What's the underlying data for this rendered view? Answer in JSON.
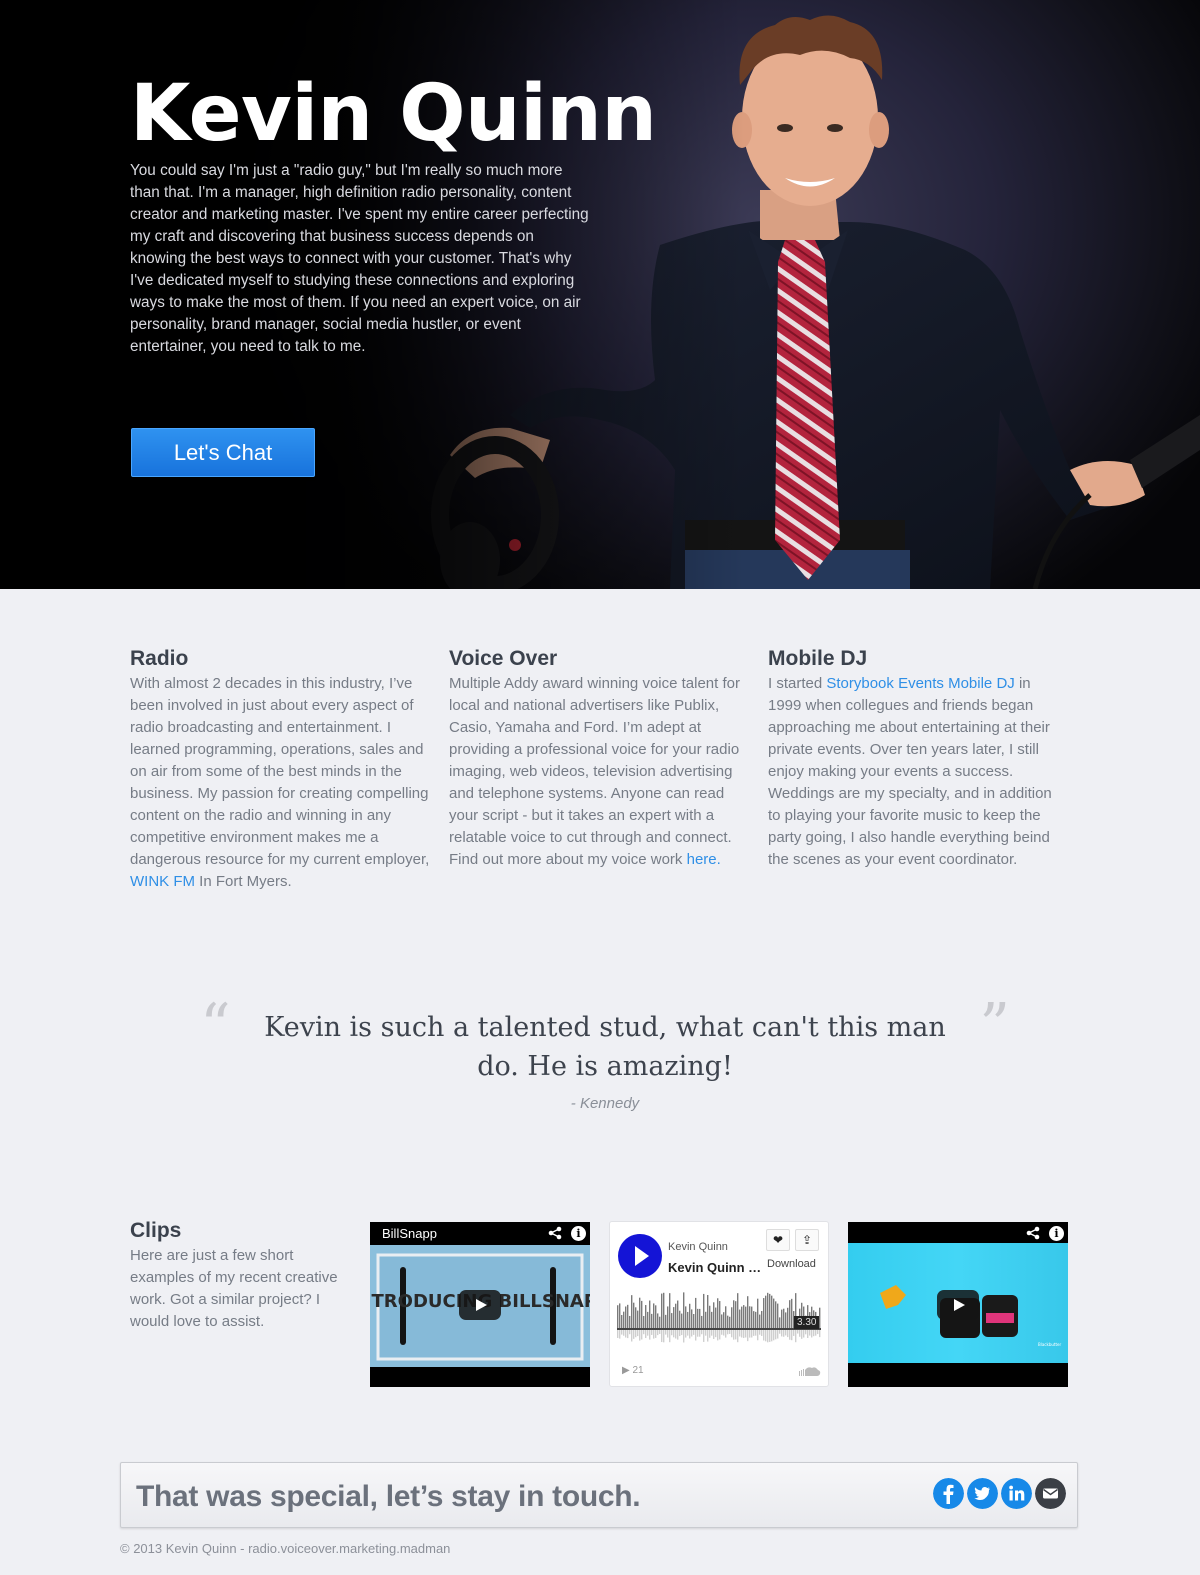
{
  "hero": {
    "name": "Kevin Quinn",
    "intro": "You could say I'm just a \"radio guy,\" but I'm really so much more than that. I'm a manager, high definition radio personality, content creator and marketing master. I've spent my entire career perfecting my craft and discovering that business success depends on knowing the best ways to connect with your customer. That's why I've dedicated myself to studying these connections and exploring ways to make the most of them. If you need an expert voice, on air personality, brand manager, social media hustler, or event entertainer, you need to talk to me.",
    "cta_label": "Let's Chat"
  },
  "services": {
    "radio": {
      "title": "Radio",
      "text_before": "With almost 2 decades in this industry, I’ve been involved in just about every aspect of radio broadcasting and entertainment. I learned programming, operations, sales and on air from some of the best minds in the business. My passion for creating compelling content on the radio and winning in any competitive environment makes me a dangerous resource for my current employer, ",
      "link": "WINK FM",
      "text_after": " In Fort Myers."
    },
    "voice": {
      "title": "Voice Over",
      "text_before": "Multiple Addy award winning voice talent for local and national advertisers like Publix, Casio, Yamaha and Ford. I’m adept at providing a professional voice for your radio imaging, web videos, television advertising and telephone systems. Anyone can read your script - but it takes an expert with a relatable voice to cut through and connect. Find out more about my voice work ",
      "link": "here."
    },
    "dj": {
      "title": "Mobile DJ",
      "text_before": "I started ",
      "link": "Storybook Events Mobile DJ",
      "text_after": " in 1999 when collegues and friends began approaching me about entertaining at their private events. Over ten years later, I still enjoy making your events a success. Weddings are my specialty, and in addition to playing your favorite music to keep the party going, I also handle everything beind the scenes as your event coordinator."
    }
  },
  "testimonial": {
    "quote": "Kevin is such a talented stud, what can't this man do. He is amazing!",
    "author": "- Kennedy"
  },
  "clips": {
    "title": "Clips",
    "text": "Here are just a few short examples of my recent creative work. Got a similar project? I would love to assist.",
    "video1": {
      "channel": "BillSnapp",
      "thumb_text": "INTRODUCING BILLSNAPP"
    },
    "soundcloud": {
      "user": "Kevin Quinn",
      "title": "Kevin Quinn Demo",
      "download": "Download",
      "duration": "3.30",
      "plays": "21"
    },
    "video3": {
      "brand": "Blackbutter"
    }
  },
  "footer": {
    "cta": "That was special, let’s stay in touch.",
    "copyright": "© 2013 Kevin Quinn - radio.voiceover.marketing.madman",
    "social": [
      "facebook-icon",
      "twitter-icon",
      "linkedin-icon",
      "email-icon"
    ]
  },
  "colors": {
    "accent": "#2f8fe6",
    "button": "#1f80e6",
    "facebook": "#1789e8",
    "twitter": "#1789e8",
    "linkedin": "#1789e8",
    "email": "#3b3f46"
  }
}
